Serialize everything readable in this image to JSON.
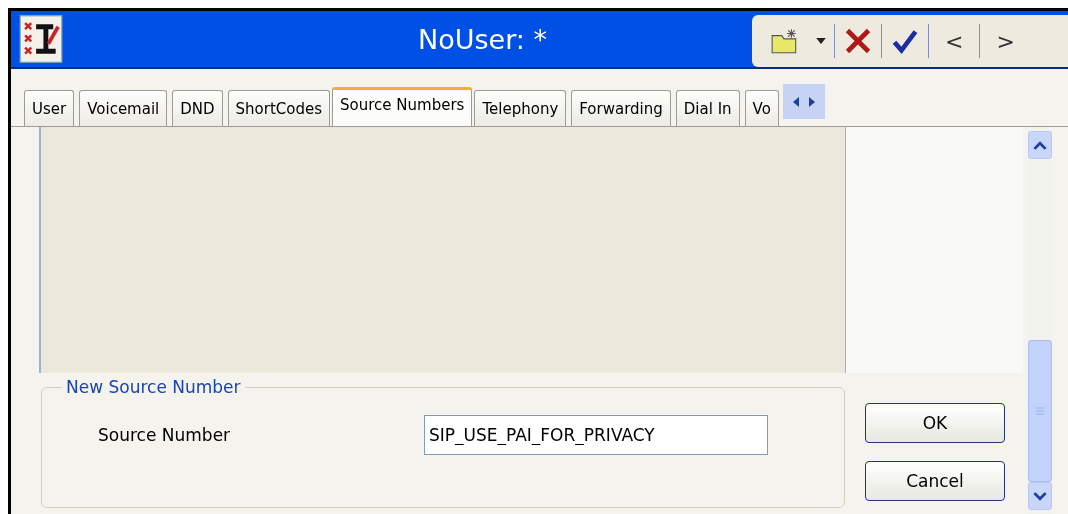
{
  "window": {
    "title": "NoUser: *"
  },
  "toolbar": {
    "buttons": [
      {
        "kind": "new"
      },
      {
        "kind": "dropdown"
      },
      {
        "kind": "cancel"
      },
      {
        "kind": "ok"
      },
      {
        "kind": "text",
        "label": "<"
      },
      {
        "kind": "text",
        "label": ">"
      }
    ]
  },
  "tabs": [
    {
      "label": "User",
      "selected": false
    },
    {
      "label": "Voicemail",
      "selected": false
    },
    {
      "label": "DND",
      "selected": false
    },
    {
      "label": "ShortCodes",
      "selected": false
    },
    {
      "label": "Source Numbers",
      "selected": true
    },
    {
      "label": "Telephony",
      "selected": false
    },
    {
      "label": "Forwarding",
      "selected": false
    },
    {
      "label": "Dial In",
      "selected": false
    },
    {
      "label": "Vo",
      "selected": false
    }
  ],
  "group": {
    "title": "New Source Number",
    "field_label": "Source Number",
    "value": "SIP_USE_PAI_FOR_PRIVACY"
  },
  "buttons": [
    "OK",
    "Cancel"
  ]
}
